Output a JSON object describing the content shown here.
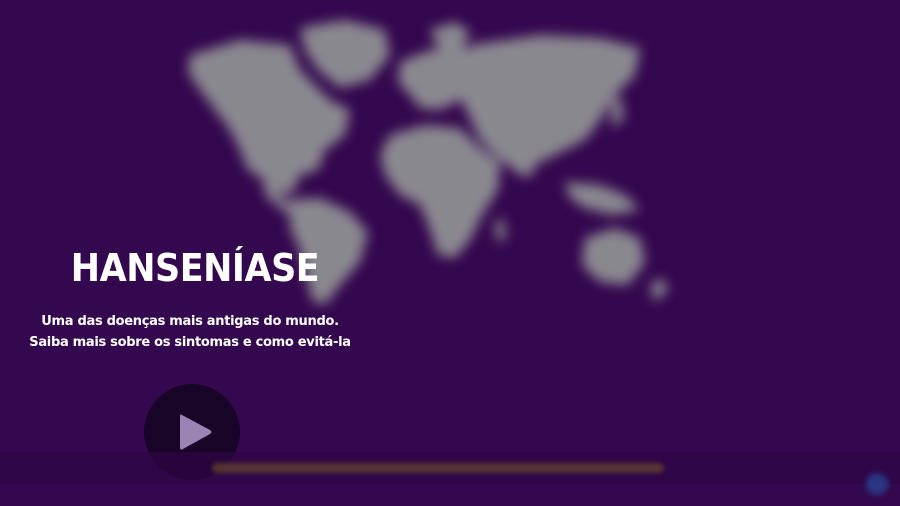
{
  "hero": {
    "title": "HANSENÍASE",
    "subtitle_line1": "Uma das doenças mais antigas do mundo.",
    "subtitle_line2": "Saiba mais sobre os sintomas e como evitá-la"
  },
  "icons": {
    "play": "play-icon",
    "map": "world-map"
  },
  "colors": {
    "background": "#34084f",
    "map_land": "#8f8f93",
    "title_text": "#ffffff",
    "play_button_bg": "#14051f",
    "play_triangle": "#9b84b3"
  }
}
